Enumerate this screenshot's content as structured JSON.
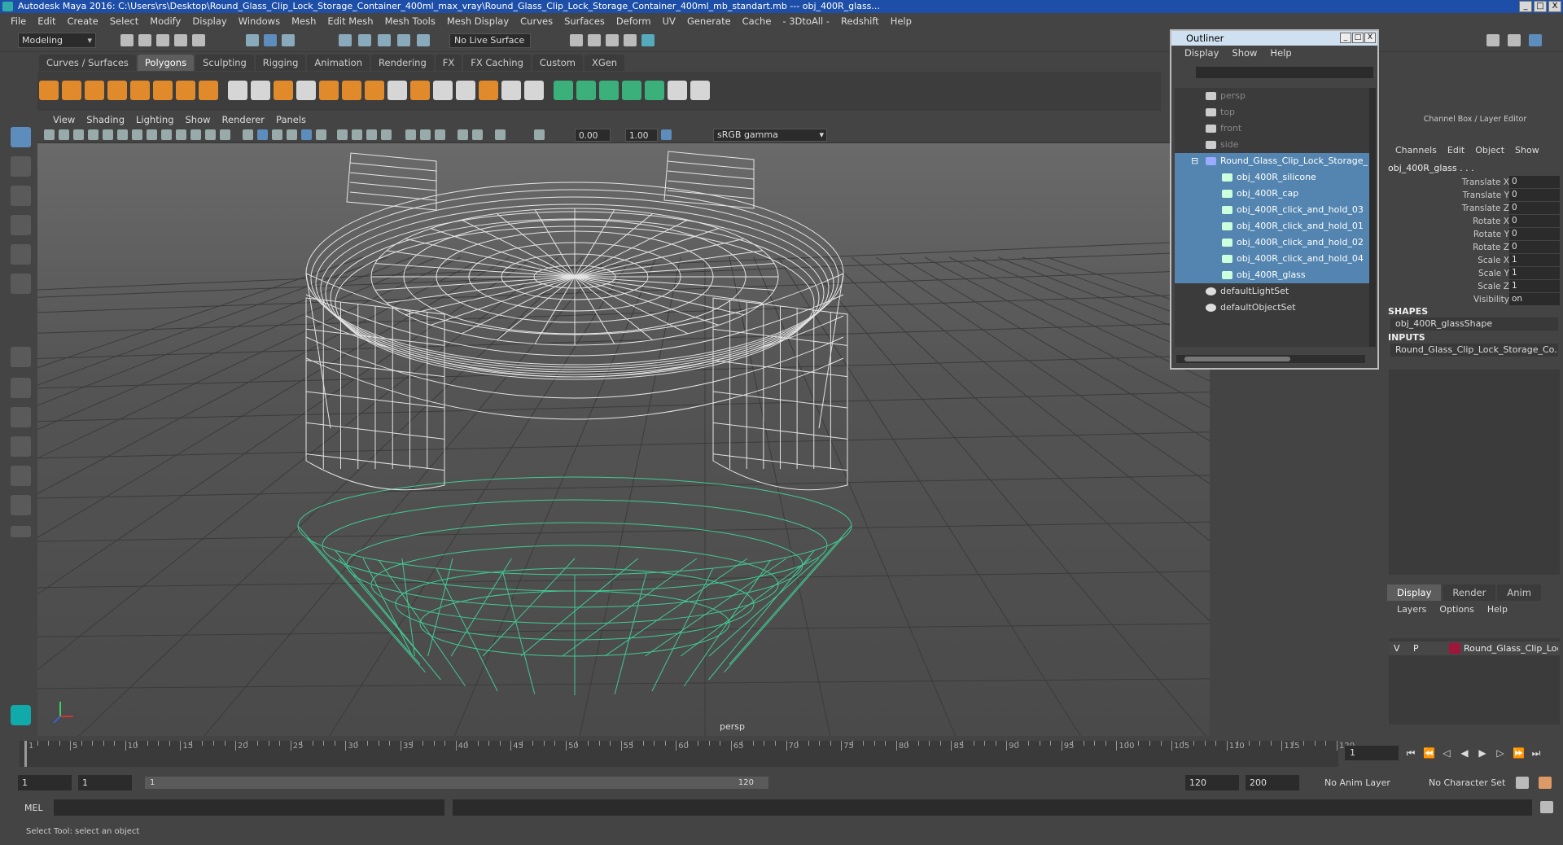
{
  "window": {
    "title": "Autodesk Maya 2016: C:\\Users\\rs\\Desktop\\Round_Glass_Clip_Lock_Storage_Container_400ml_max_vray\\Round_Glass_Clip_Lock_Storage_Container_400ml_mb_standart.mb  ---  obj_400R_glass...",
    "controls": [
      "_",
      "□",
      "X"
    ]
  },
  "menubar": [
    "File",
    "Edit",
    "Create",
    "Select",
    "Modify",
    "Display",
    "Windows",
    "Mesh",
    "Edit Mesh",
    "Mesh Tools",
    "Mesh Display",
    "Curves",
    "Surfaces",
    "Deform",
    "UV",
    "Generate",
    "Cache",
    "- 3DtoAll -",
    "Redshift",
    "Help"
  ],
  "status_line": {
    "mode": "Modeling",
    "live_surface": "No Live Surface"
  },
  "shelf_tabs": [
    {
      "label": "Curves / Surfaces",
      "active": false
    },
    {
      "label": "Polygons",
      "active": true
    },
    {
      "label": "Sculpting",
      "active": false
    },
    {
      "label": "Rigging",
      "active": false
    },
    {
      "label": "Animation",
      "active": false
    },
    {
      "label": "Rendering",
      "active": false
    },
    {
      "label": "FX",
      "active": false
    },
    {
      "label": "FX Caching",
      "active": false
    },
    {
      "label": "Custom",
      "active": false
    },
    {
      "label": "XGen",
      "active": false
    }
  ],
  "viewport": {
    "menu": [
      "View",
      "Shading",
      "Lighting",
      "Show",
      "Renderer",
      "Panels"
    ],
    "exposure": "0.00",
    "gamma_value": "1.00",
    "color_space": "sRGB gamma",
    "camera_label": "persp"
  },
  "outliner": {
    "title": "Outliner",
    "menu": [
      "Display",
      "Show",
      "Help"
    ],
    "items": [
      {
        "label": "persp",
        "kind": "camera",
        "selected": false,
        "dim": true
      },
      {
        "label": "top",
        "kind": "camera",
        "selected": false,
        "dim": true
      },
      {
        "label": "front",
        "kind": "camera",
        "selected": false,
        "dim": true
      },
      {
        "label": "side",
        "kind": "camera",
        "selected": false,
        "dim": true
      },
      {
        "label": "Round_Glass_Clip_Lock_Storage_",
        "kind": "group",
        "selected": true,
        "dim": false
      },
      {
        "label": "obj_400R_silicone",
        "kind": "mesh",
        "selected": true,
        "dim": false
      },
      {
        "label": "obj_400R_cap",
        "kind": "mesh",
        "selected": true,
        "dim": false
      },
      {
        "label": "obj_400R_click_and_hold_03",
        "kind": "mesh",
        "selected": true,
        "dim": false
      },
      {
        "label": "obj_400R_click_and_hold_01",
        "kind": "mesh",
        "selected": true,
        "dim": false
      },
      {
        "label": "obj_400R_click_and_hold_02",
        "kind": "mesh",
        "selected": true,
        "dim": false
      },
      {
        "label": "obj_400R_click_and_hold_04",
        "kind": "mesh",
        "selected": true,
        "dim": false
      },
      {
        "label": "obj_400R_glass",
        "kind": "mesh",
        "selected": true,
        "dim": false
      },
      {
        "label": "defaultLightSet",
        "kind": "set",
        "selected": false,
        "dim": false
      },
      {
        "label": "defaultObjectSet",
        "kind": "set",
        "selected": false,
        "dim": false
      }
    ]
  },
  "channel_box": {
    "header": "Channel Box / Layer Editor",
    "menu": [
      "Channels",
      "Edit",
      "Object",
      "Show"
    ],
    "object_name": "obj_400R_glass . . .",
    "attributes": [
      {
        "name": "Translate X",
        "value": "0"
      },
      {
        "name": "Translate Y",
        "value": "0"
      },
      {
        "name": "Translate Z",
        "value": "0"
      },
      {
        "name": "Rotate X",
        "value": "0"
      },
      {
        "name": "Rotate Y",
        "value": "0"
      },
      {
        "name": "Rotate Z",
        "value": "0"
      },
      {
        "name": "Scale X",
        "value": "1"
      },
      {
        "name": "Scale Y",
        "value": "1"
      },
      {
        "name": "Scale Z",
        "value": "1"
      },
      {
        "name": "Visibility",
        "value": "on"
      }
    ],
    "shapes_label": "SHAPES",
    "shape_name": "obj_400R_glassShape",
    "inputs_label": "INPUTS",
    "input_name": "Round_Glass_Clip_Lock_Storage_Co..."
  },
  "layer_editor": {
    "tabs": [
      {
        "label": "Display",
        "active": true
      },
      {
        "label": "Render",
        "active": false
      },
      {
        "label": "Anim",
        "active": false
      }
    ],
    "menu": [
      "Layers",
      "Options",
      "Help"
    ],
    "layer": {
      "v": "V",
      "p": "P",
      "name": "Round_Glass_Clip_Loc",
      "color": "#a0163a"
    }
  },
  "timeline": {
    "ticks": [
      "1",
      "5",
      "10",
      "15",
      "20",
      "25",
      "30",
      "35",
      "40",
      "45",
      "50",
      "55",
      "60",
      "65",
      "70",
      "75",
      "80",
      "85",
      "90",
      "95",
      "100",
      "105",
      "110",
      "115",
      "120"
    ],
    "current_frame": "1"
  },
  "range": {
    "start": "1",
    "playback_start": "1",
    "slider_start": "1",
    "slider_end": "120",
    "playback_end": "120",
    "end": "200",
    "anim_layer": "No Anim Layer",
    "character_set": "No Character Set"
  },
  "command_line": {
    "label": "MEL"
  },
  "help_line": "Select Tool: select an object",
  "colors": {
    "titlebar": "#1e4fa8",
    "selection": "#5385b0",
    "wire_glass": "#3fe0a0",
    "wire_white": "#ffffff"
  }
}
